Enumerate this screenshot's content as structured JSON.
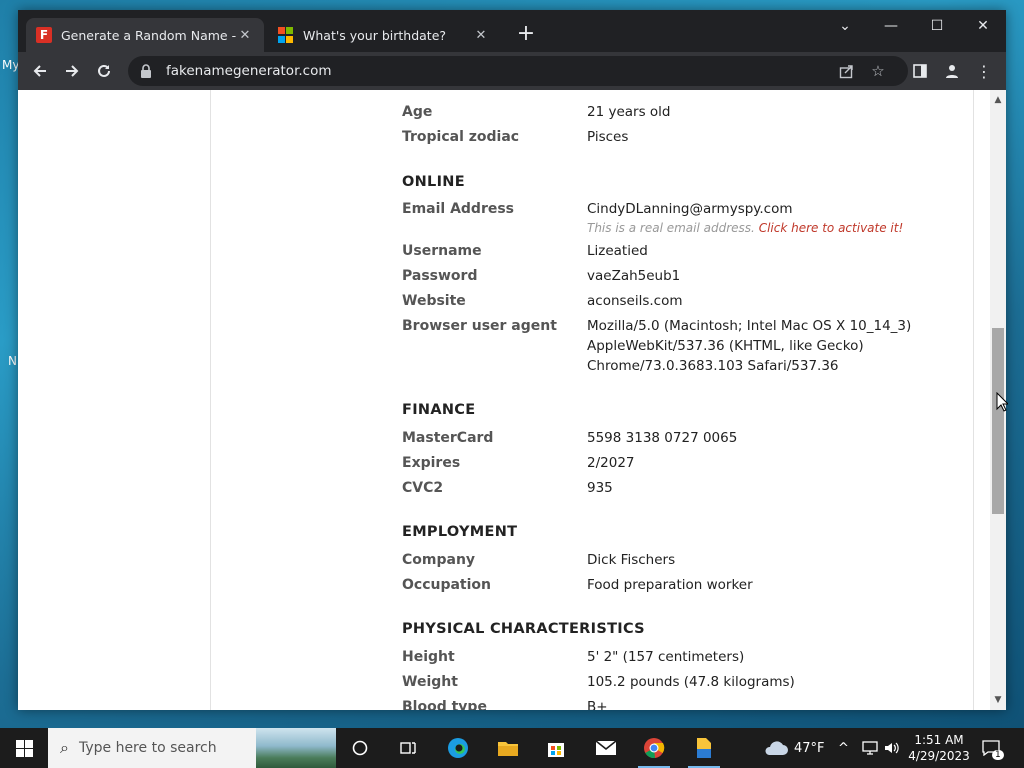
{
  "desktop": {
    "edge_labels": [
      "My",
      "N"
    ]
  },
  "browser": {
    "tabs": [
      {
        "title": "Generate a Random Name - Fake",
        "favicon": "fakenamegenerator-icon",
        "active": true
      },
      {
        "title": "What's your birthdate?",
        "favicon": "microsoft-icon",
        "active": false
      }
    ],
    "new_tab": "+",
    "address": "fakenamegenerator.com"
  },
  "page": {
    "rows_top": [
      {
        "label": "Age",
        "value": "21 years old"
      },
      {
        "label": "Tropical zodiac",
        "value": "Pisces"
      }
    ],
    "online": {
      "heading": "ONLINE",
      "email_label": "Email Address",
      "email_value": "CindyDLanning@armyspy.com",
      "email_note": "This is a real email address.",
      "email_link": "Click here to activate it!",
      "username_label": "Username",
      "username_value": "Lizeatied",
      "password_label": "Password",
      "password_value": "vaeZah5eub1",
      "website_label": "Website",
      "website_value": "aconseils.com",
      "ua_label": "Browser user agent",
      "ua_lines": [
        "Mozilla/5.0 (Macintosh; Intel Mac OS X 10_14_3)",
        "AppleWebKit/537.36 (KHTML, like Gecko)",
        "Chrome/73.0.3683.103 Safari/537.36"
      ]
    },
    "finance": {
      "heading": "FINANCE",
      "card_label": "MasterCard",
      "card_value": "5598 3138 0727 0065",
      "expires_label": "Expires",
      "expires_value": "2/2027",
      "cvc_label": "CVC2",
      "cvc_value": "935"
    },
    "employment": {
      "heading": "EMPLOYMENT",
      "company_label": "Company",
      "company_value": "Dick Fischers",
      "occupation_label": "Occupation",
      "occupation_value": "Food preparation worker"
    },
    "physical": {
      "heading": "PHYSICAL CHARACTERISTICS",
      "height_label": "Height",
      "height_value": "5' 2\" (157 centimeters)",
      "weight_label": "Weight",
      "weight_value": "105.2 pounds (47.8 kilograms)",
      "blood_label": "Blood type",
      "blood_value": "B+"
    }
  },
  "taskbar": {
    "search_placeholder": "Type here to search",
    "weather": "47°F",
    "time": "1:51 AM",
    "date": "4/29/2023",
    "notifications": "1"
  },
  "colors": {
    "chrome_dark": "#202124",
    "chrome_toolbar": "#35363a",
    "link_red": "#c0392b",
    "taskbar": "#1c1c1c"
  }
}
